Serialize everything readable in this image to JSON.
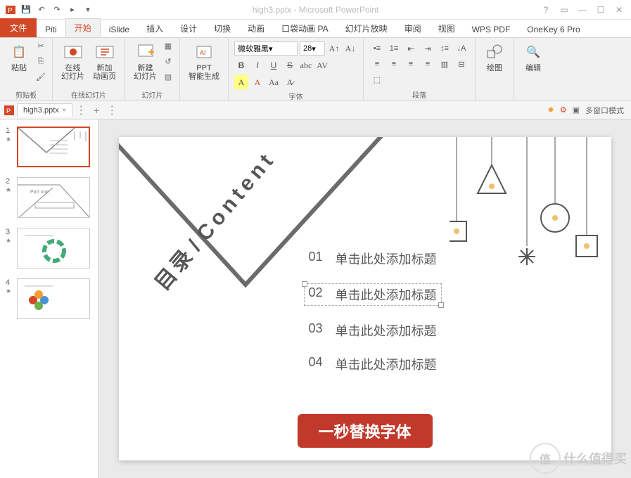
{
  "app_title": "high3.pptx - Microsoft PowerPoint",
  "tabs": {
    "file": "文件",
    "piti": "Piti",
    "home": "开始",
    "islide": "iSlide",
    "insert": "插入",
    "design": "设计",
    "transition": "切换",
    "animation": "动画",
    "pocket": "口袋动画 PA",
    "slideshow": "幻灯片放映",
    "review": "审阅",
    "view": "视图",
    "wps": "WPS PDF",
    "onekey": "OneKey 6 Pro"
  },
  "ribbon": {
    "clipboard": {
      "paste": "粘贴",
      "label": "剪贴板"
    },
    "slides": {
      "online": "在线\n幻灯片",
      "newanim": "新加\n动画页",
      "label1": "在线幻灯片",
      "newslide": "新建\n幻灯片",
      "label2": "幻灯片"
    },
    "ppt_gen": {
      "btn": "PPT\n智能生成",
      "label": ""
    },
    "font": {
      "name": "微软雅黑",
      "size": "28",
      "label": "字体"
    },
    "paragraph": {
      "label": "段落"
    },
    "drawing": {
      "label": "绘图"
    },
    "editing": {
      "label": "编辑"
    }
  },
  "document": {
    "tab_name": "high3.pptx",
    "multi_window": "多窗口模式"
  },
  "thumbnails": [
    {
      "num": "1",
      "star": "★"
    },
    {
      "num": "2",
      "star": "★"
    },
    {
      "num": "3",
      "star": "★"
    },
    {
      "num": "4",
      "star": "★"
    }
  ],
  "slide": {
    "diag_label": "目录",
    "diag_en": "Content",
    "toc": [
      {
        "num": "01",
        "text": "单击此处添加标题"
      },
      {
        "num": "02",
        "text": "单击此处添加标题"
      },
      {
        "num": "03",
        "text": "单击此处添加标题"
      },
      {
        "num": "04",
        "text": "单击此处添加标题"
      }
    ],
    "banner": "一秒替换字体"
  },
  "watermark": {
    "icon": "值",
    "text": "什么值得买"
  }
}
